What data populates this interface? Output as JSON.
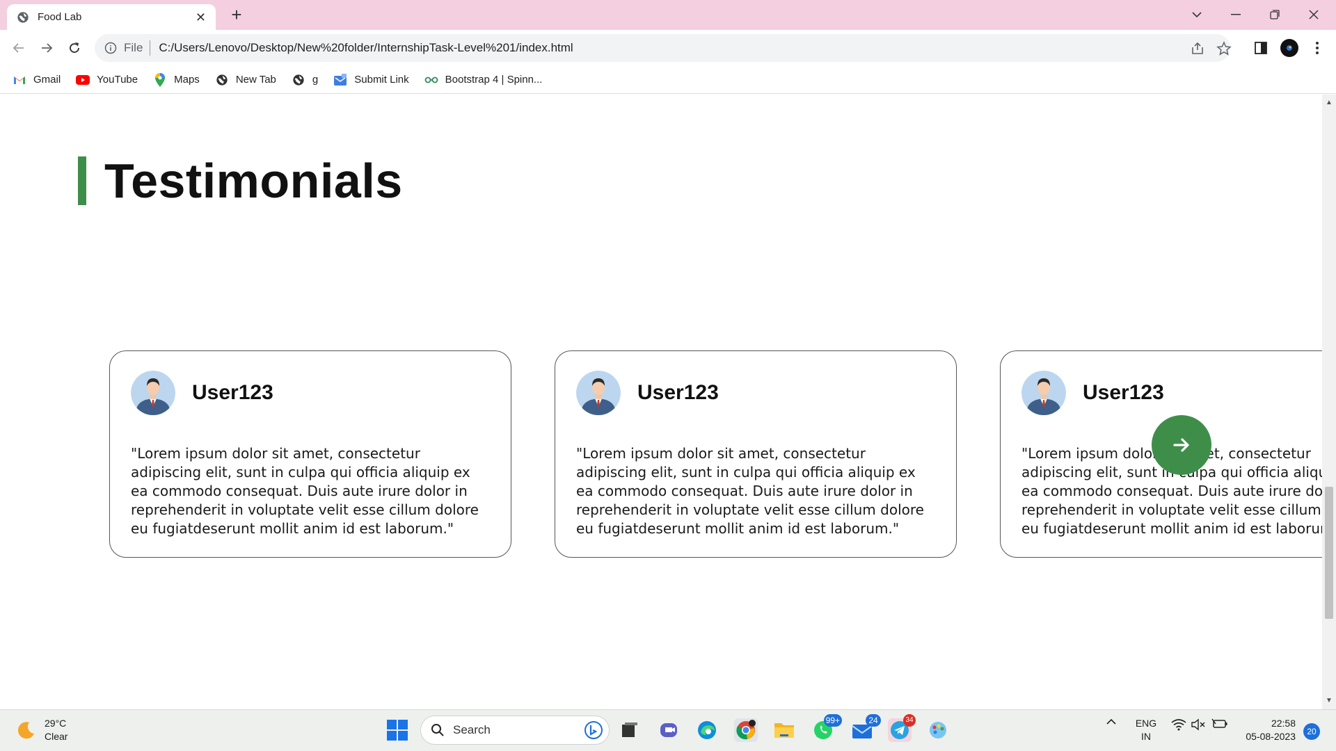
{
  "browser": {
    "tab_title": "Food Lab",
    "scheme": "File",
    "url": "C:/Users/Lenovo/Desktop/New%20folder/InternshipTask-Level%201/index.html",
    "bookmarks": [
      {
        "label": "Gmail",
        "icon": "gmail-icon"
      },
      {
        "label": "YouTube",
        "icon": "youtube-icon"
      },
      {
        "label": "Maps",
        "icon": "maps-icon"
      },
      {
        "label": "New Tab",
        "icon": "globe-icon"
      },
      {
        "label": "g",
        "icon": "globe-icon"
      },
      {
        "label": "Submit Link",
        "icon": "submit-link-icon"
      },
      {
        "label": "Bootstrap 4 | Spinn...",
        "icon": "bootstrap-icon"
      }
    ]
  },
  "page": {
    "heading": "Testimonials",
    "accent_color": "#3e8e4a",
    "testimonials": [
      {
        "user": "User123",
        "quote": "\"Lorem ipsum dolor sit amet, consectetur adipiscing elit, sunt in culpa qui officia aliquip ex ea commodo consequat. Duis aute irure dolor in reprehenderit in voluptate velit esse cillum dolore eu fugiatdeserunt mollit anim id est laborum.\""
      },
      {
        "user": "User123",
        "quote": "\"Lorem ipsum dolor sit amet, consectetur adipiscing elit, sunt in culpa qui officia aliquip ex ea commodo consequat. Duis aute irure dolor in reprehenderit in voluptate velit esse cillum dolore eu fugiatdeserunt mollit anim id est laborum.\""
      },
      {
        "user": "User123",
        "quote": "\"Lorem ipsum dolor sit amet, consectetur adipiscing elit, sunt in culpa qui officia aliquip ex ea commodo consequat. Duis aute irure dolor in reprehenderit in voluptate velit esse cillum dolore eu fugiatdeserunt mollit anim id est laborum.\""
      }
    ]
  },
  "taskbar": {
    "weather_temp": "29°C",
    "weather_desc": "Clear",
    "search_placeholder": "Search",
    "whatsapp_badge": "99+",
    "mail_badge": "24",
    "telegram_badge": "34",
    "lang_top": "ENG",
    "lang_bottom": "IN",
    "time": "22:58",
    "date": "05-08-2023",
    "notifications": "20"
  }
}
